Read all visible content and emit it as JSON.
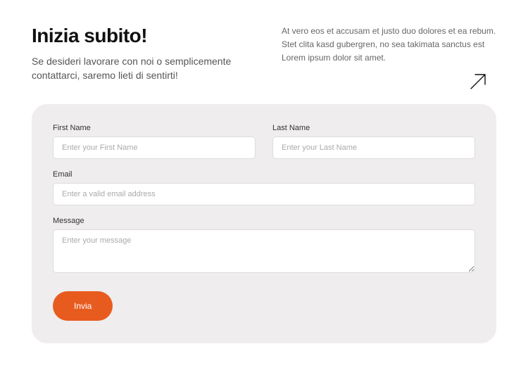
{
  "header": {
    "title": "Inizia subito!",
    "subtitle": "Se desideri lavorare con noi o semplicemente contattarci, saremo lieti di sentirti!",
    "desc": "At vero eos et accusam et justo duo dolores et ea rebum. Stet clita kasd gubergren, no sea takimata sanctus est Lorem ipsum dolor sit amet."
  },
  "form": {
    "first_name": {
      "label": "First Name",
      "placeholder": "Enter your First Name"
    },
    "last_name": {
      "label": "Last Name",
      "placeholder": "Enter your Last Name"
    },
    "email": {
      "label": "Email",
      "placeholder": "Enter a valid email address"
    },
    "message": {
      "label": "Message",
      "placeholder": "Enter your message"
    },
    "submit": "Invia"
  }
}
